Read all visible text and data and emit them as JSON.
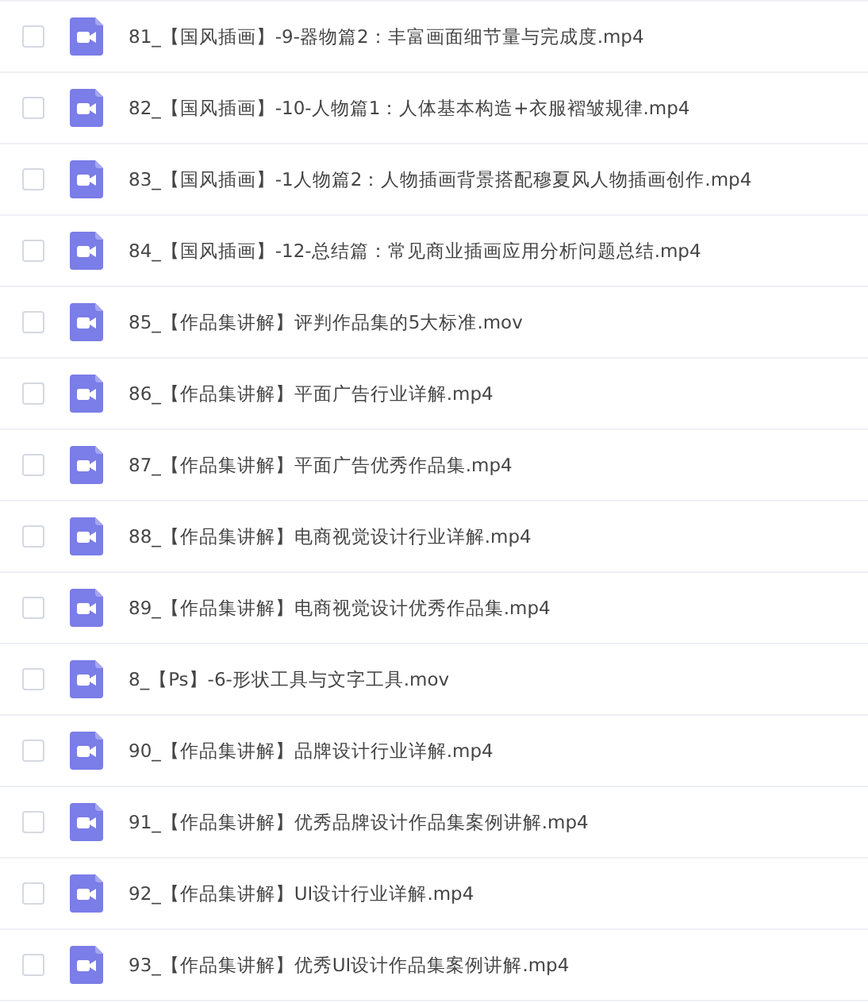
{
  "files": [
    {
      "name": "81_【国风插画】-9-器物篇2：丰富画面细节量与完成度.mp4",
      "checked": false
    },
    {
      "name": "82_【国风插画】-10-人物篇1：人体基本构造+衣服褶皱规律.mp4",
      "checked": false
    },
    {
      "name": "83_【国风插画】-1人物篇2：人物插画背景搭配穆夏风人物插画创作.mp4",
      "checked": false
    },
    {
      "name": "84_【国风插画】-12-总结篇：常见商业插画应用分析问题总结.mp4",
      "checked": false
    },
    {
      "name": "85_【作品集讲解】评判作品集的5大标准.mov",
      "checked": false
    },
    {
      "name": "86_【作品集讲解】平面广告行业详解.mp4",
      "checked": false
    },
    {
      "name": "87_【作品集讲解】平面广告优秀作品集.mp4",
      "checked": false
    },
    {
      "name": "88_【作品集讲解】电商视觉设计行业详解.mp4",
      "checked": false
    },
    {
      "name": "89_【作品集讲解】电商视觉设计优秀作品集.mp4",
      "checked": false
    },
    {
      "name": "8_【Ps】-6-形状工具与文字工具.mov",
      "checked": false
    },
    {
      "name": "90_【作品集讲解】品牌设计行业详解.mp4",
      "checked": false
    },
    {
      "name": "91_【作品集讲解】优秀品牌设计作品集案例讲解.mp4",
      "checked": false
    },
    {
      "name": "92_【作品集讲解】UI设计行业详解.mp4",
      "checked": false
    },
    {
      "name": "93_【作品集讲解】优秀UI设计作品集案例讲解.mp4",
      "checked": false
    }
  ]
}
